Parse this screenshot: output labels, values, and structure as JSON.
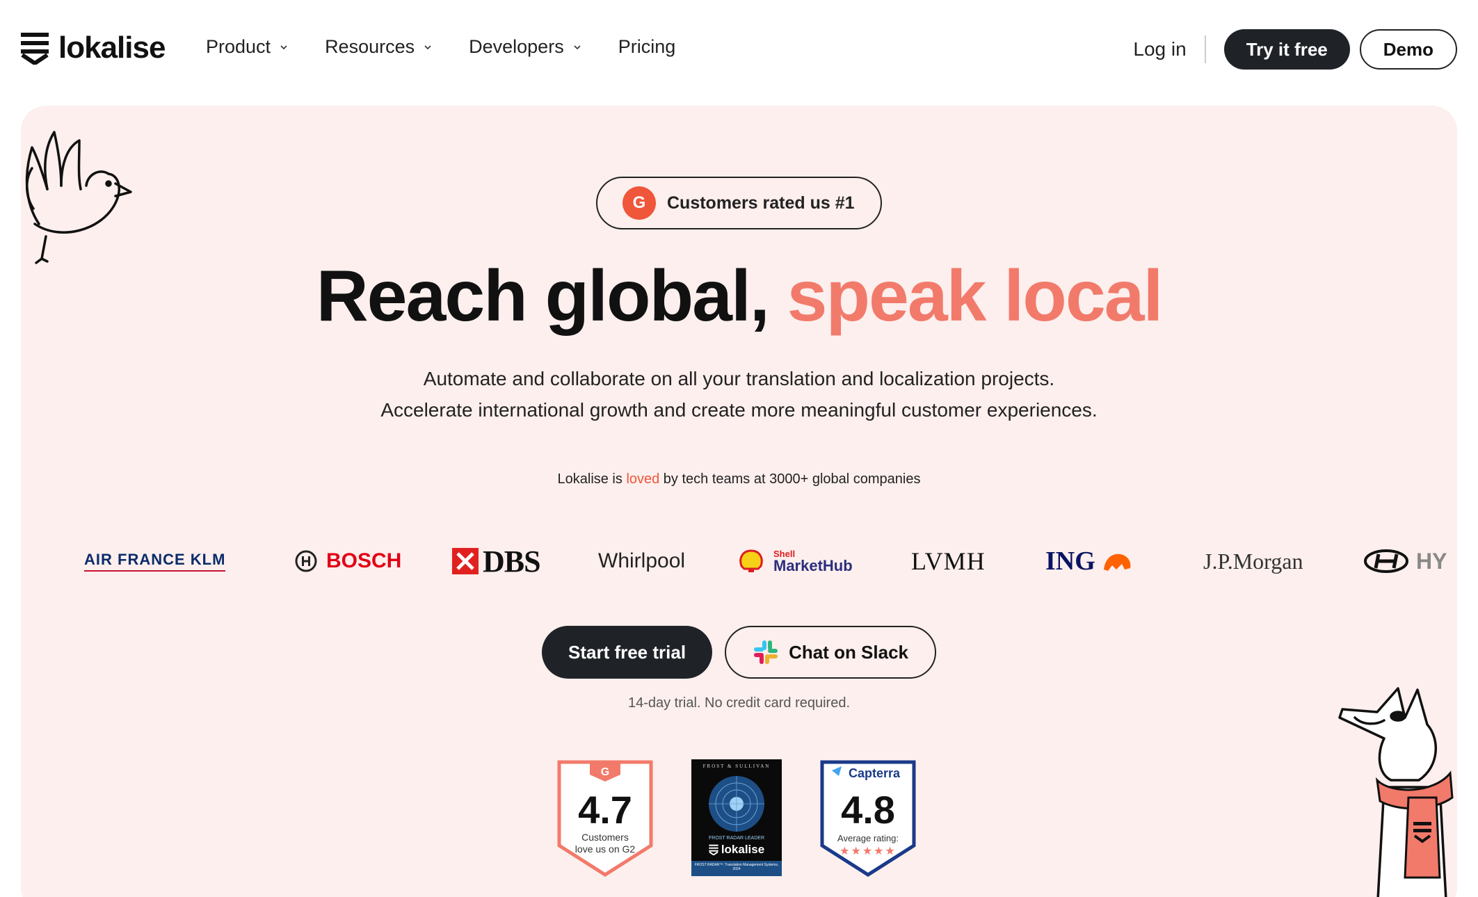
{
  "nav": {
    "logo_text": "lokalise",
    "menu": [
      {
        "label": "Product",
        "has_dropdown": true
      },
      {
        "label": "Resources",
        "has_dropdown": true
      },
      {
        "label": "Developers",
        "has_dropdown": true
      },
      {
        "label": "Pricing",
        "has_dropdown": false
      }
    ],
    "login_label": "Log in",
    "try_label": "Try it free",
    "demo_label": "Demo"
  },
  "hero": {
    "badge_icon_text": "G",
    "badge_text": "Customers rated us #1",
    "headline_main": "Reach global, ",
    "headline_accent": "speak local",
    "subtitle_line1": "Automate and collaborate on all your translation and localization projects.",
    "subtitle_line2": "Accelerate international growth and create more meaningful customer experiences.",
    "loved_prefix": "Lokalise is ",
    "loved_word": "loved",
    "loved_suffix": " by tech teams at 3000+ global companies",
    "start_label": "Start free trial",
    "slack_label": "Chat on Slack",
    "trial_note": "14-day trial. No credit card required."
  },
  "companies": {
    "airfrance": "AIR FRANCE KLM",
    "bosch": "BOSCH",
    "dbs": "DBS",
    "whirlpool": "Whirlpool",
    "shell_small": "Shell",
    "shell_big": "MarketHub",
    "lvmh": "LVMH",
    "ing": "ING",
    "jpmorgan": "J.P.Morgan",
    "hyundai": "HY"
  },
  "awards": {
    "g2": {
      "score": "4.7",
      "line1": "Customers",
      "line2": "love us on G2"
    },
    "frost": {
      "top": "FROST & SULLIVAN",
      "leader": "FROST RADAR LEADER",
      "brand": "lokalise",
      "footer": "FROST RADAR™: Translation Management Systems, 2024"
    },
    "capterra": {
      "brand": "Capterra",
      "score": "4.8",
      "label": "Average rating:",
      "stars": "★★★★★"
    }
  },
  "colors": {
    "accent": "#f27a6b",
    "hero_bg": "#fcefed",
    "dark_button": "#1f2328",
    "g2_red": "#f0563a",
    "capterra_blue": "#1a3a8a"
  }
}
